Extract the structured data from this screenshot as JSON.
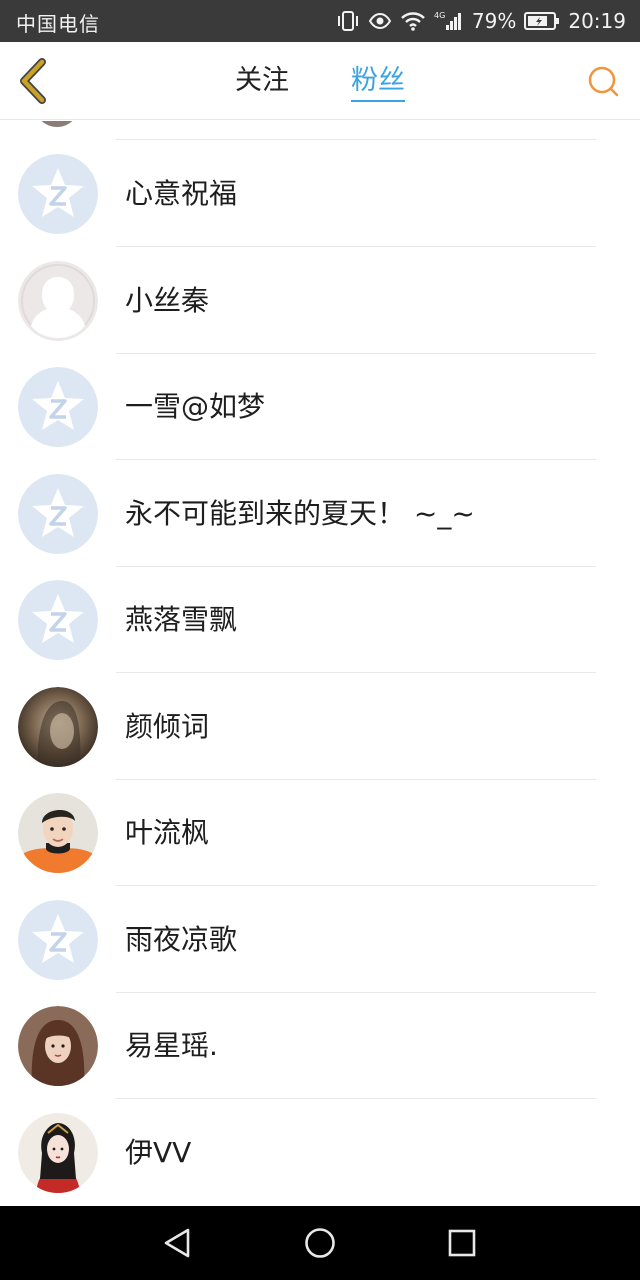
{
  "status_bar": {
    "carrier": "中国电信",
    "network": "4G",
    "battery": "79%",
    "time": "20:19"
  },
  "nav": {
    "tabs": [
      {
        "label": "关注",
        "active": false
      },
      {
        "label": "粉丝",
        "active": true
      }
    ]
  },
  "colors": {
    "accent": "#3aa3e3",
    "back_arrow": "#c9a227",
    "search_icon": "#f0953a",
    "default_avatar_bg": "#dde6f3"
  },
  "fans": [
    {
      "name": "心意祝福",
      "avatar": "default-qzone-icon"
    },
    {
      "name": "小丝秦",
      "avatar": "silhouette-icon"
    },
    {
      "name": "一雪@如梦",
      "avatar": "default-qzone-icon"
    },
    {
      "name": "永不可能到来的夏天！ ~_~",
      "avatar": "default-qzone-icon"
    },
    {
      "name": "燕落雪飘",
      "avatar": "default-qzone-icon"
    },
    {
      "name": "颜倾词",
      "avatar": "photo-dark-hair"
    },
    {
      "name": "叶流枫",
      "avatar": "photo-boy-orange"
    },
    {
      "name": "雨夜凉歌",
      "avatar": "default-qzone-icon"
    },
    {
      "name": "易星瑶.",
      "avatar": "photo-girl-brown"
    },
    {
      "name": "伊VV",
      "avatar": "photo-red-costume"
    }
  ]
}
